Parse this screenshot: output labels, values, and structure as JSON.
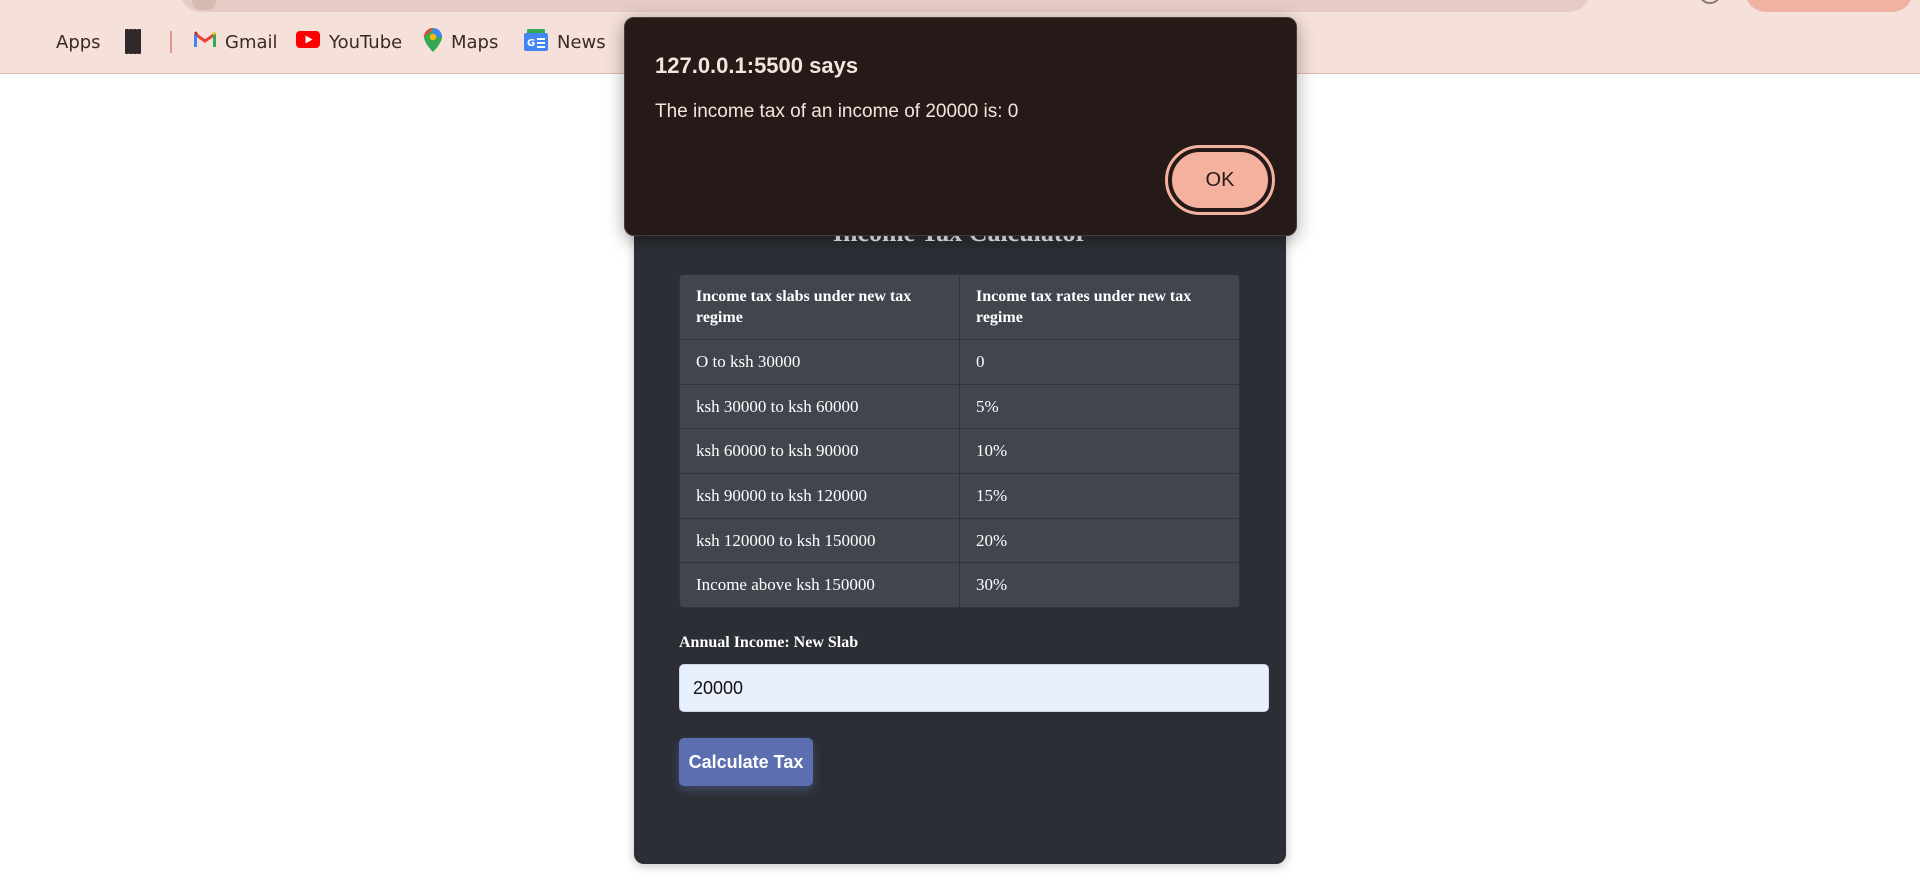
{
  "bookmarks": {
    "items": [
      {
        "label": "Apps",
        "icon": "apps-grid-icon"
      },
      {
        "label": "",
        "icon": "tiles-icon"
      },
      {
        "label": "Gmail",
        "icon": "gmail-icon"
      },
      {
        "label": "YouTube",
        "icon": "youtube-icon"
      },
      {
        "label": "Maps",
        "icon": "maps-icon"
      },
      {
        "label": "News",
        "icon": "news-icon"
      }
    ]
  },
  "dialog": {
    "origin": "127.0.0.1:5500 says",
    "message": "The income tax of an income of 20000 is: 0",
    "ok_label": "OK"
  },
  "calculator": {
    "title": "Income Tax Calculator",
    "table": {
      "headers": [
        "Income tax slabs under new tax regime",
        "Income tax rates under new tax regime"
      ],
      "rows": [
        [
          "O to ksh 30000",
          "0"
        ],
        [
          "ksh 30000 to ksh 60000",
          "5%"
        ],
        [
          "ksh 60000 to ksh 90000",
          "10%"
        ],
        [
          "ksh 90000 to ksh 120000",
          "15%"
        ],
        [
          "ksh 120000 to ksh 150000",
          "20%"
        ],
        [
          "Income above ksh 150000",
          "30%"
        ]
      ]
    },
    "income_label": "Annual Income: New Slab",
    "income_value": "20000",
    "button_label": "Calculate Tax"
  },
  "colors": {
    "chrome_bg": "#f6e0da",
    "card_bg": "#2b2e34",
    "table_cell": "#41454d",
    "button_blue": "#5b6fb0",
    "dialog_bg": "#251a17",
    "ok_button": "#f4b19e"
  }
}
